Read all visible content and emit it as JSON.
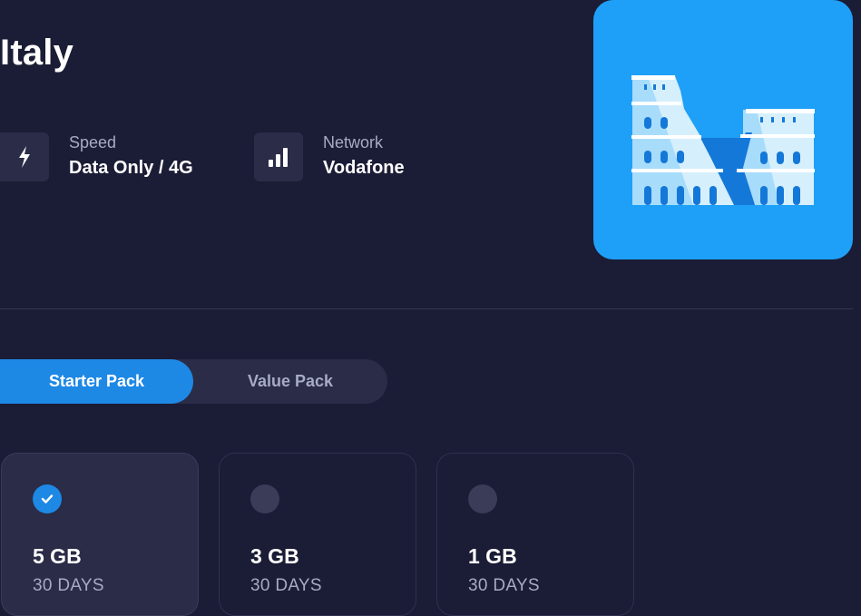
{
  "country": {
    "name": "Italy"
  },
  "info": {
    "speed": {
      "label": "Speed",
      "value": "Data Only / 4G",
      "icon": "lightning-icon"
    },
    "network": {
      "label": "Network",
      "value": "Vodafone",
      "icon": "signal-bars-icon"
    }
  },
  "hero": {
    "icon": "colosseum-illustration",
    "background": "#1ea0f8"
  },
  "pack_tabs": [
    {
      "label": "Starter Pack",
      "active": true
    },
    {
      "label": "Value Pack",
      "active": false
    }
  ],
  "plans": [
    {
      "size": "5 GB",
      "duration": "30 DAYS",
      "selected": true
    },
    {
      "size": "3 GB",
      "duration": "30 DAYS",
      "selected": false
    },
    {
      "size": "1 GB",
      "duration": "30 DAYS",
      "selected": false
    }
  ],
  "colors": {
    "background": "#1b1c35",
    "accent": "#1e88e5",
    "muted_text": "#a8abc4"
  }
}
